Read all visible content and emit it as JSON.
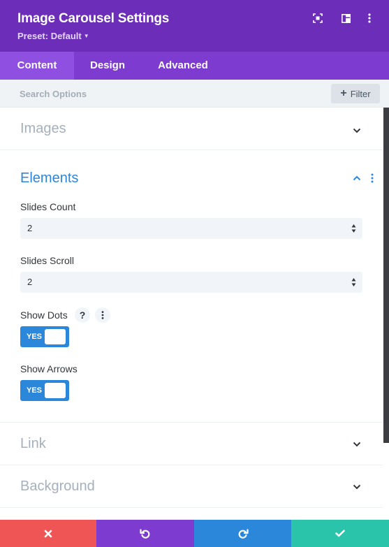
{
  "header": {
    "title": "Image Carousel Settings",
    "preset_label": "Preset: Default"
  },
  "tabs": [
    {
      "label": "Content"
    },
    {
      "label": "Design"
    },
    {
      "label": "Advanced"
    }
  ],
  "search": {
    "placeholder": "Search Options",
    "filter_label": "Filter"
  },
  "sections": {
    "images": {
      "title": "Images"
    },
    "elements": {
      "title": "Elements",
      "slides_count": {
        "label": "Slides Count",
        "value": "2"
      },
      "slides_scroll": {
        "label": "Slides Scroll",
        "value": "2"
      },
      "show_dots": {
        "label": "Show Dots",
        "toggle": "YES"
      },
      "show_arrows": {
        "label": "Show Arrows",
        "toggle": "YES"
      }
    },
    "link": {
      "title": "Link"
    },
    "background": {
      "title": "Background"
    }
  },
  "colors": {
    "header_bg": "#6c2eb9",
    "tab_bar_bg": "#7d3bcf",
    "active_tab_bg": "#8f4fe0",
    "accent_blue": "#2b87da",
    "cancel_red": "#ef5555",
    "undo_purple": "#7d3bcf",
    "redo_blue": "#2b87da",
    "save_green": "#29c4a9"
  },
  "icons": {
    "header": [
      "expand-icon",
      "split-view-icon",
      "more-vertical-icon"
    ],
    "footer": [
      "close-icon",
      "undo-icon",
      "redo-icon",
      "check-icon"
    ]
  }
}
